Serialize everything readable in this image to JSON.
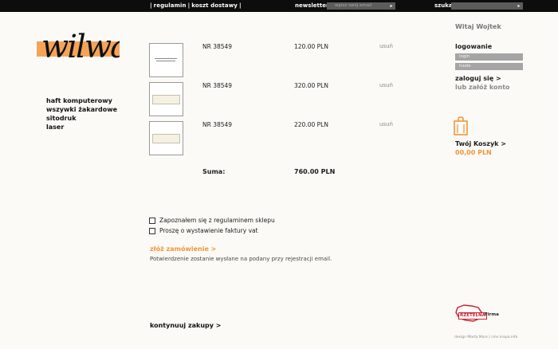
{
  "topbar": {
    "nav": [
      "regulamin",
      "koszt dostawy"
    ],
    "newsletter_label": "newsletter",
    "newsletter_placeholder": "wpisz swój email",
    "search_label": "szukaj"
  },
  "logo": {
    "text": "wilwa"
  },
  "menu": [
    "haft komputerowy",
    "wszywki żakardowe",
    "sitodruk",
    "laser"
  ],
  "cart": {
    "items": [
      {
        "nr": "NR 38549",
        "price": "120.00 PLN",
        "remove": "usuń"
      },
      {
        "nr": "NR 38549",
        "price": "320.00 PLN",
        "remove": "usuń"
      },
      {
        "nr": "NR 38549",
        "price": "220.00 PLN",
        "remove": "usuń"
      }
    ],
    "sum_label": "Suma:",
    "sum_value": "760.00 PLN"
  },
  "checks": [
    "Zapoznałem się z regulaminem sklepu",
    "Proszę o wystawienie faktury vat"
  ],
  "order": {
    "link": "złóż zamówienie >",
    "info": "Potwierdzenie zostanie wysłane na podany przy rejestracji email."
  },
  "continue": "kontynuuj zakupy >",
  "sidebar": {
    "welcome": "Witaj Wojtek",
    "login_title": "logowanie",
    "login_field": "login",
    "password_field": "hasło",
    "login_link": "zaloguj się  >",
    "register_link": "lub załóż konto",
    "basket_link": "Twój Koszyk >",
    "basket_total": "00,00 PLN"
  },
  "badge": {
    "left": "RZETELNA",
    "right": "Firma"
  },
  "credits": "design Marta Marx | cms kropa.info",
  "colors": {
    "accent": "#f39536",
    "logo_bar": "#f3a458",
    "topbar": "#0d0d0d"
  }
}
